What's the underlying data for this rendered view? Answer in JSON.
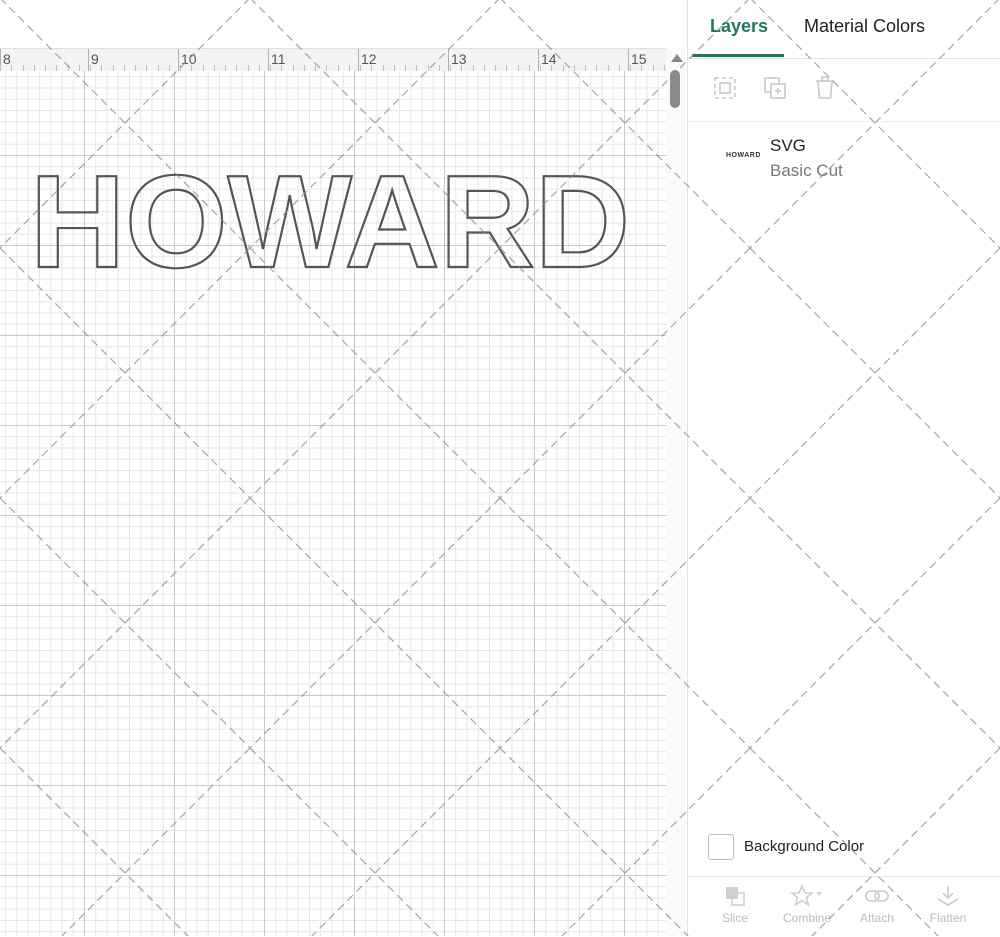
{
  "canvas": {
    "ruler_labels": [
      "8",
      "9",
      "10",
      "11",
      "12",
      "13",
      "14",
      "15"
    ],
    "design_text": "HOWARD"
  },
  "panel": {
    "tabs": [
      {
        "label": "Layers",
        "active": true
      },
      {
        "label": "Material Colors",
        "active": false
      }
    ],
    "toolbar": [
      {
        "icon": "group-icon",
        "enabled": false
      },
      {
        "icon": "duplicate-icon",
        "enabled": false
      },
      {
        "icon": "delete-icon",
        "enabled": false
      }
    ],
    "layers": [
      {
        "thumbnail_text": "HOWARD",
        "name": "SVG",
        "operation": "Basic Cut"
      }
    ],
    "background_color_label": "Background Color",
    "bottom_tools": [
      {
        "label": "Slice",
        "icon": "slice-icon"
      },
      {
        "label": "Combine",
        "icon": "combine-icon"
      },
      {
        "label": "Attach",
        "icon": "attach-icon"
      },
      {
        "label": "Flatten",
        "icon": "flatten-icon"
      }
    ]
  },
  "colors": {
    "accent": "#1f7a5c",
    "disabled": "#bbbbbb"
  }
}
